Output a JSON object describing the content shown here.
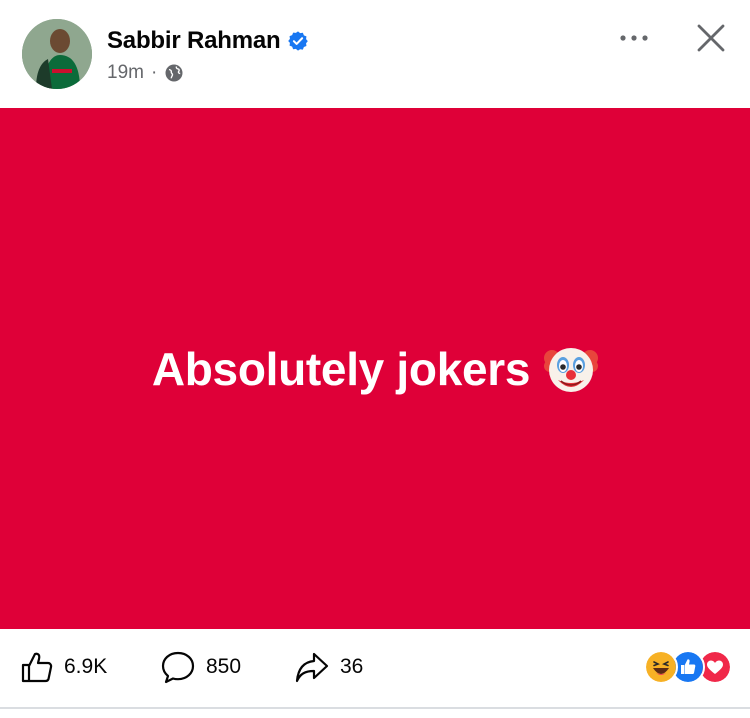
{
  "post": {
    "author": {
      "name": "Sabbir Rahman",
      "verified": true,
      "avatar_icon": "profile-photo"
    },
    "timestamp": "19m",
    "separator": "·",
    "audience_icon": "globe-icon",
    "text": "Absolutely jokers",
    "emoji_icon": "clown-face-icon",
    "background_color": "#df0038"
  },
  "header_actions": {
    "more_icon": "more-options-icon",
    "close_icon": "close-icon"
  },
  "actions": {
    "likes": "6.9K",
    "comments": "850",
    "shares": "36"
  },
  "reactions": [
    "haha",
    "like",
    "love"
  ],
  "colors": {
    "verified_blue": "#1877f2",
    "like_blue": "#1877f2",
    "love_red": "#f02849",
    "haha_yellow": "#f7b125",
    "meta_gray": "#65676b"
  }
}
